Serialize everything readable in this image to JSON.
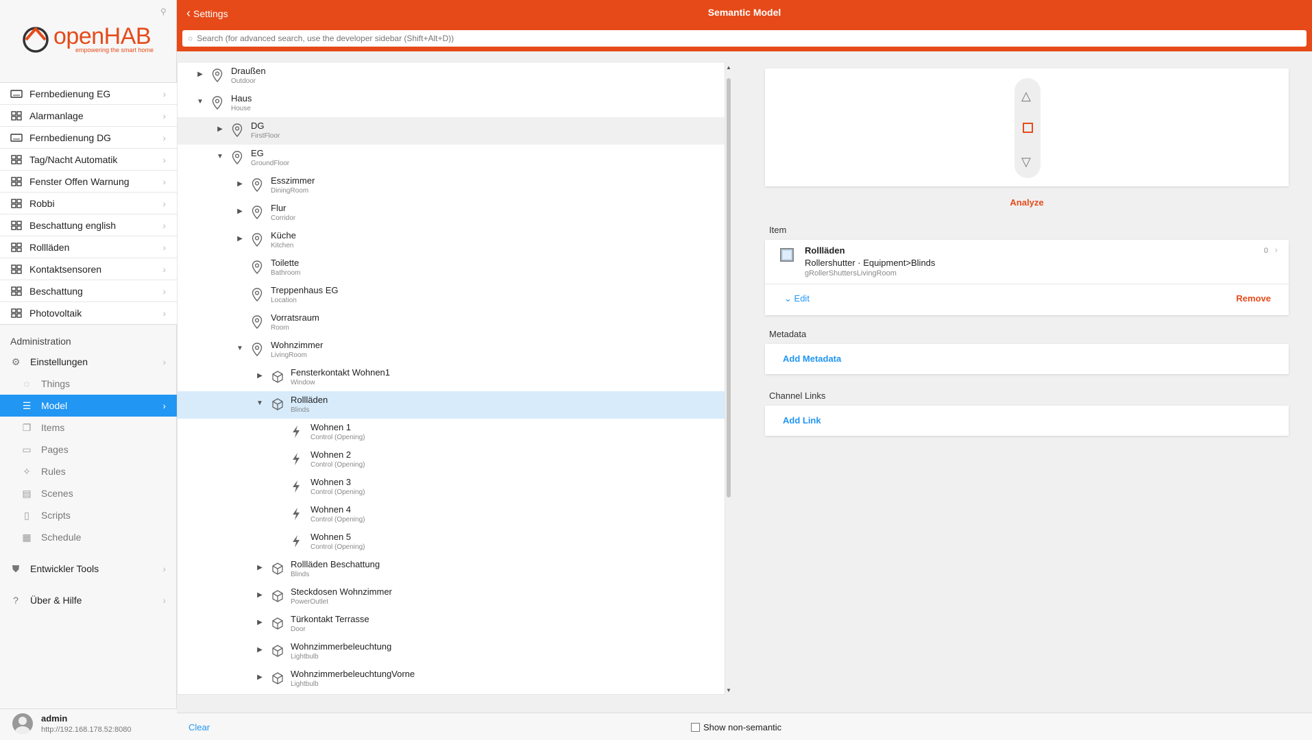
{
  "brand": {
    "name_a": "open",
    "name_b": "HAB",
    "tagline": "empowering the smart home"
  },
  "pages": [
    {
      "label": "Fernbedienung EG",
      "icon": "remote-icon"
    },
    {
      "label": "Alarmanlage",
      "icon": "grid-icon"
    },
    {
      "label": "Fernbedienung DG",
      "icon": "remote-icon"
    },
    {
      "label": "Tag/Nacht Automatik",
      "icon": "grid-icon"
    },
    {
      "label": "Fenster Offen Warnung",
      "icon": "grid-icon"
    },
    {
      "label": "Robbi",
      "icon": "grid-icon"
    },
    {
      "label": "Beschattung english",
      "icon": "grid-icon"
    },
    {
      "label": "Rollläden",
      "icon": "grid-icon"
    },
    {
      "label": "Kontaktsensoren",
      "icon": "grid-icon"
    },
    {
      "label": "Beschattung",
      "icon": "grid-icon"
    },
    {
      "label": "Photovoltaik",
      "icon": "grid-icon"
    }
  ],
  "admin": {
    "title": "Administration",
    "settings": "Einstellungen",
    "things": "Things",
    "model": "Model",
    "items": "Items",
    "pages": "Pages",
    "rules": "Rules",
    "scenes": "Scenes",
    "scripts": "Scripts",
    "schedule": "Schedule",
    "dev_tools": "Entwickler Tools",
    "help": "Über & Hilfe"
  },
  "user": {
    "name": "admin",
    "url": "http://192.168.178.52:8080"
  },
  "header": {
    "back": "Settings",
    "title": "Semantic Model",
    "search_placeholder": "Search (for advanced search, use the developer sidebar (Shift+Alt+D))"
  },
  "tree": [
    {
      "label": "Draußen",
      "sub": "Outdoor",
      "level": 0,
      "toggle": "collapsed",
      "type": "location"
    },
    {
      "label": "Haus",
      "sub": "House",
      "level": 0,
      "toggle": "expanded",
      "type": "location"
    },
    {
      "label": "DG",
      "sub": "FirstFloor",
      "level": 1,
      "toggle": "collapsed",
      "type": "location",
      "hl": "grey"
    },
    {
      "label": "EG",
      "sub": "GroundFloor",
      "level": 1,
      "toggle": "expanded",
      "type": "location"
    },
    {
      "label": "Esszimmer",
      "sub": "DiningRoom",
      "level": 2,
      "toggle": "collapsed",
      "type": "location"
    },
    {
      "label": "Flur",
      "sub": "Corridor",
      "level": 2,
      "toggle": "collapsed",
      "type": "location"
    },
    {
      "label": "Küche",
      "sub": "Kitchen",
      "level": 2,
      "toggle": "collapsed",
      "type": "location"
    },
    {
      "label": "Toilette",
      "sub": "Bathroom",
      "level": 2,
      "toggle": "none",
      "type": "location"
    },
    {
      "label": "Treppenhaus EG",
      "sub": "Location",
      "level": 2,
      "toggle": "none",
      "type": "location"
    },
    {
      "label": "Vorratsraum",
      "sub": "Room",
      "level": 2,
      "toggle": "none",
      "type": "location"
    },
    {
      "label": "Wohnzimmer",
      "sub": "LivingRoom",
      "level": 2,
      "toggle": "expanded",
      "type": "location"
    },
    {
      "label": "Fensterkontakt Wohnen1",
      "sub": "Window",
      "level": 3,
      "toggle": "collapsed",
      "type": "equipment"
    },
    {
      "label": "Rollläden",
      "sub": "Blinds",
      "level": 3,
      "toggle": "expanded",
      "type": "equipment",
      "hl": "blue"
    },
    {
      "label": "Wohnen 1",
      "sub": "Control (Opening)",
      "level": 4,
      "toggle": "none",
      "type": "point"
    },
    {
      "label": "Wohnen 2",
      "sub": "Control (Opening)",
      "level": 4,
      "toggle": "none",
      "type": "point"
    },
    {
      "label": "Wohnen 3",
      "sub": "Control (Opening)",
      "level": 4,
      "toggle": "none",
      "type": "point"
    },
    {
      "label": "Wohnen 4",
      "sub": "Control (Opening)",
      "level": 4,
      "toggle": "none",
      "type": "point"
    },
    {
      "label": "Wohnen 5",
      "sub": "Control (Opening)",
      "level": 4,
      "toggle": "none",
      "type": "point"
    },
    {
      "label": "Rollläden Beschattung",
      "sub": "Blinds",
      "level": 3,
      "toggle": "collapsed",
      "type": "equipment"
    },
    {
      "label": "Steckdosen Wohnzimmer",
      "sub": "PowerOutlet",
      "level": 3,
      "toggle": "collapsed",
      "type": "equipment"
    },
    {
      "label": "Türkontakt Terrasse",
      "sub": "Door",
      "level": 3,
      "toggle": "collapsed",
      "type": "equipment"
    },
    {
      "label": "Wohnzimmerbeleuchtung",
      "sub": "Lightbulb",
      "level": 3,
      "toggle": "collapsed",
      "type": "equipment"
    },
    {
      "label": "WohnzimmerbeleuchtungVorne",
      "sub": "Lightbulb",
      "level": 3,
      "toggle": "collapsed",
      "type": "equipment"
    }
  ],
  "detail": {
    "analyze": "Analyze",
    "item_section": "Item",
    "item_name": "Rollläden",
    "item_type": "Rollershutter · Equipment>Blinds",
    "item_id": "gRollerShuttersLivingRoom",
    "item_count": "0",
    "edit": "Edit",
    "remove": "Remove",
    "metadata_section": "Metadata",
    "add_metadata": "Add Metadata",
    "channel_section": "Channel Links",
    "add_link": "Add Link"
  },
  "footer": {
    "clear": "Clear",
    "show_non_semantic": "Show non-semantic"
  },
  "colors": {
    "accent": "#e64a19",
    "active": "#2196f3",
    "selected_row": "#d7ebfb"
  }
}
